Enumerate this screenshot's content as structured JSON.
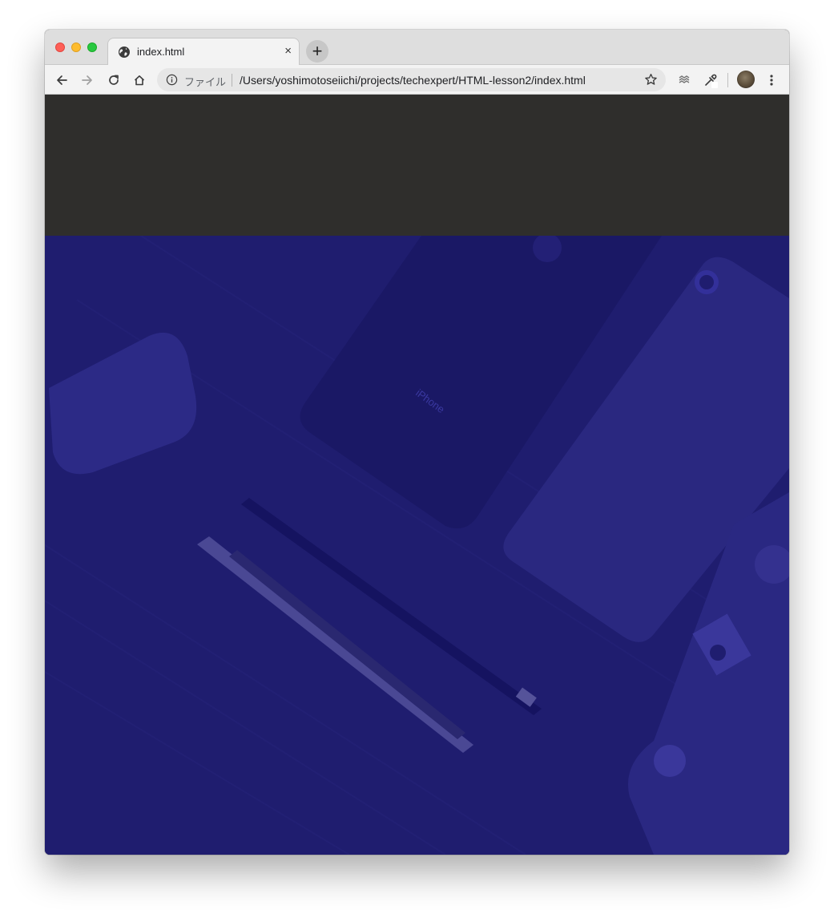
{
  "browser": {
    "tab": {
      "title": "index.html",
      "close_glyph": "×",
      "favicon": "globe-icon"
    },
    "new_tab_glyph": "+",
    "toolbar": {
      "back_icon": "back-arrow-icon",
      "forward_icon": "forward-arrow-icon",
      "reload_icon": "reload-icon",
      "home_icon": "home-icon"
    },
    "address": {
      "scheme_label": "ファイル",
      "url": "/Users/yoshimotoseiichi/projects/techexpert/HTML-lesson2/index.html",
      "info_icon": "info-icon",
      "bookmark_icon": "star-icon"
    },
    "extensions": [
      "extension-icon",
      "eyedropper-icon"
    ],
    "menu_icon": "kebab-menu-icon"
  },
  "page": {
    "header_color": "#2f2e2c",
    "hero_overlay_color": "#1f1d6f",
    "hero_image_text": "iPhone"
  }
}
